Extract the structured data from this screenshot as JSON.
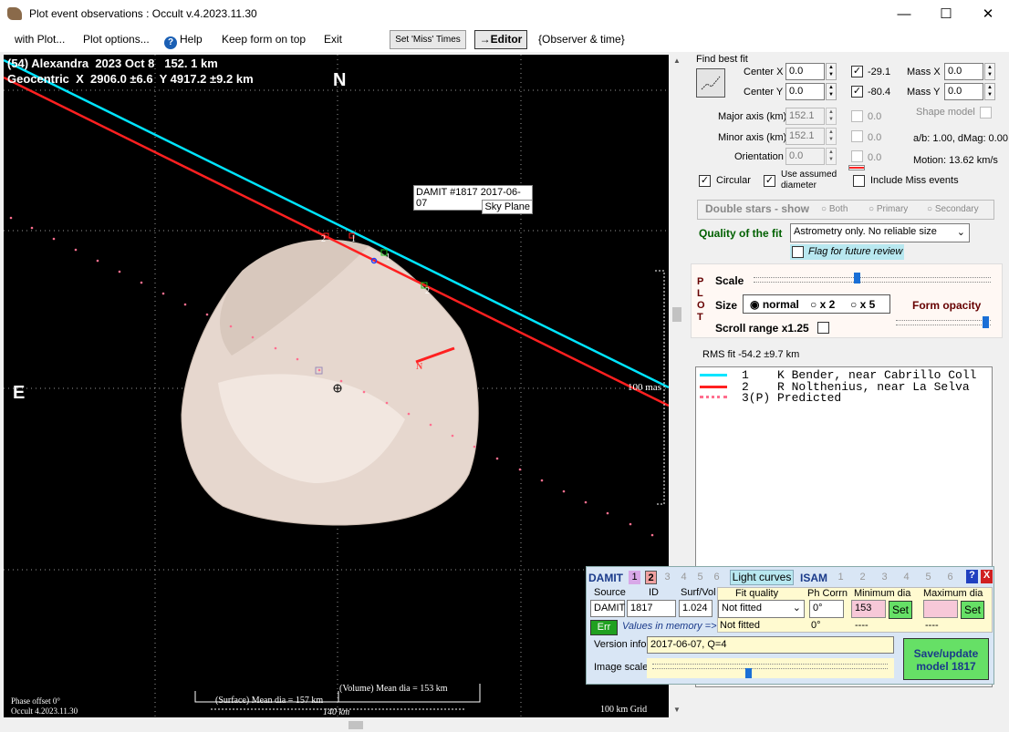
{
  "window": {
    "title": "Plot event observations : Occult v.4.2023.11.30",
    "minimize": "—",
    "maximize": "☐",
    "close": "✕"
  },
  "menu": {
    "with_plot": "with Plot...",
    "plot_options": "Plot options...",
    "help": "Help",
    "keep_on_top": "Keep form on top",
    "exit": "Exit",
    "set_miss_times": "Set 'Miss' Times",
    "editor": "→Editor",
    "observer_time": "{Observer & time}"
  },
  "plot": {
    "header1": "(54) Alexandra  2023 Oct 8   152. 1 km",
    "header2": "Geocentric  X  2906.0 ±6.6  Y 4917.2 ±9.2 km",
    "north": "N",
    "east": "E",
    "damit_label": "DAMIT #1817 2017-06-07",
    "sky_plane": "Sky Plane",
    "scale_mas": "100 mas",
    "phase_offset": "Phase offset 0°",
    "version": "Occult 4.2023.11.30",
    "grid": "100 km Grid",
    "surface_dia": "(Surface) Mean dia = 157 km",
    "volume_dia": "(Volume) Mean dia = 153 km",
    "km140": "140 km",
    "chord_labels": [
      "2",
      "1",
      "1",
      "2"
    ],
    "motion_n": "N"
  },
  "fit": {
    "find_best_fit": "Find best fit",
    "center_x_label": "Center X",
    "center_x": "0.0",
    "center_y_label": "Center Y",
    "center_y": "0.0",
    "val1": "-29.1",
    "val2": "-80.4",
    "mass_x_label": "Mass X",
    "mass_x": "0.0",
    "mass_y_label": "Mass Y",
    "mass_y": "0.0",
    "major_label": "Major axis (km)",
    "major": "152.1",
    "minor_label": "Minor axis (km)",
    "minor": "152.1",
    "orient_label": "Orientation",
    "orient": "0.0",
    "zero": "0.0",
    "shape_model": "Shape model",
    "ab": "a/b: 1.00, dMag: 0.00",
    "motion": "Motion: 13.62 km/s",
    "circular": "Circular",
    "assumed1": "Use assumed",
    "assumed2": "diameter",
    "include_miss": "Include Miss events",
    "double_stars": "Double stars - show",
    "both": "Both",
    "primary": "Primary",
    "secondary": "Secondary",
    "quality_label": "Quality of the fit",
    "quality_value": "Astrometry only. No reliable size",
    "flag_review": "Flag for future review"
  },
  "plotbox": {
    "letters": [
      "P",
      "L",
      "O",
      "T"
    ],
    "scale": "Scale",
    "size": "Size",
    "normal": "normal",
    "x2": "x 2",
    "x5": "x 5",
    "form_opacity": "Form opacity",
    "scroll_range": "Scroll range x1.25"
  },
  "rms": "RMS fit -54.2 ±9.7 km",
  "legend": [
    {
      "text": "1    K Bender, near Cabrillo Coll",
      "color": "#00e5ff"
    },
    {
      "text": "2    R Nolthenius, near La Selva",
      "color": "#ff2020"
    },
    {
      "text": "3(P) Predicted",
      "color": "#ff6f8f"
    }
  ],
  "damit": {
    "title": "DAMIT",
    "nums": [
      "1",
      "2",
      "3",
      "4",
      "5",
      "6"
    ],
    "light_curves": "Light curves",
    "isam": "ISAM",
    "q": "?",
    "x": "X",
    "source_label": "Source",
    "id_label": "ID",
    "surfvol_label": "Surf/Vol",
    "source": "DAMIT",
    "id": "1817",
    "surfvol": "1.024",
    "fit_quality_label": "Fit quality",
    "ph_corrn_label": "Ph Corrn",
    "min_dia_label": "Minimum dia",
    "max_dia_label": "Maximum dia",
    "fit_quality": "Not fitted",
    "ph_corrn": "0°",
    "min_dia": "153",
    "max_dia": "",
    "set": "Set",
    "err": "Err",
    "values_memory": "Values in memory =>",
    "not_fitted_mem": "Not fitted",
    "ph_mem": "0°",
    "dashes": "----",
    "version_label": "Version info",
    "version": "2017-06-07, Q=4",
    "image_scale": "Image scale",
    "save1": "Save/update",
    "save2": "model 1817"
  }
}
